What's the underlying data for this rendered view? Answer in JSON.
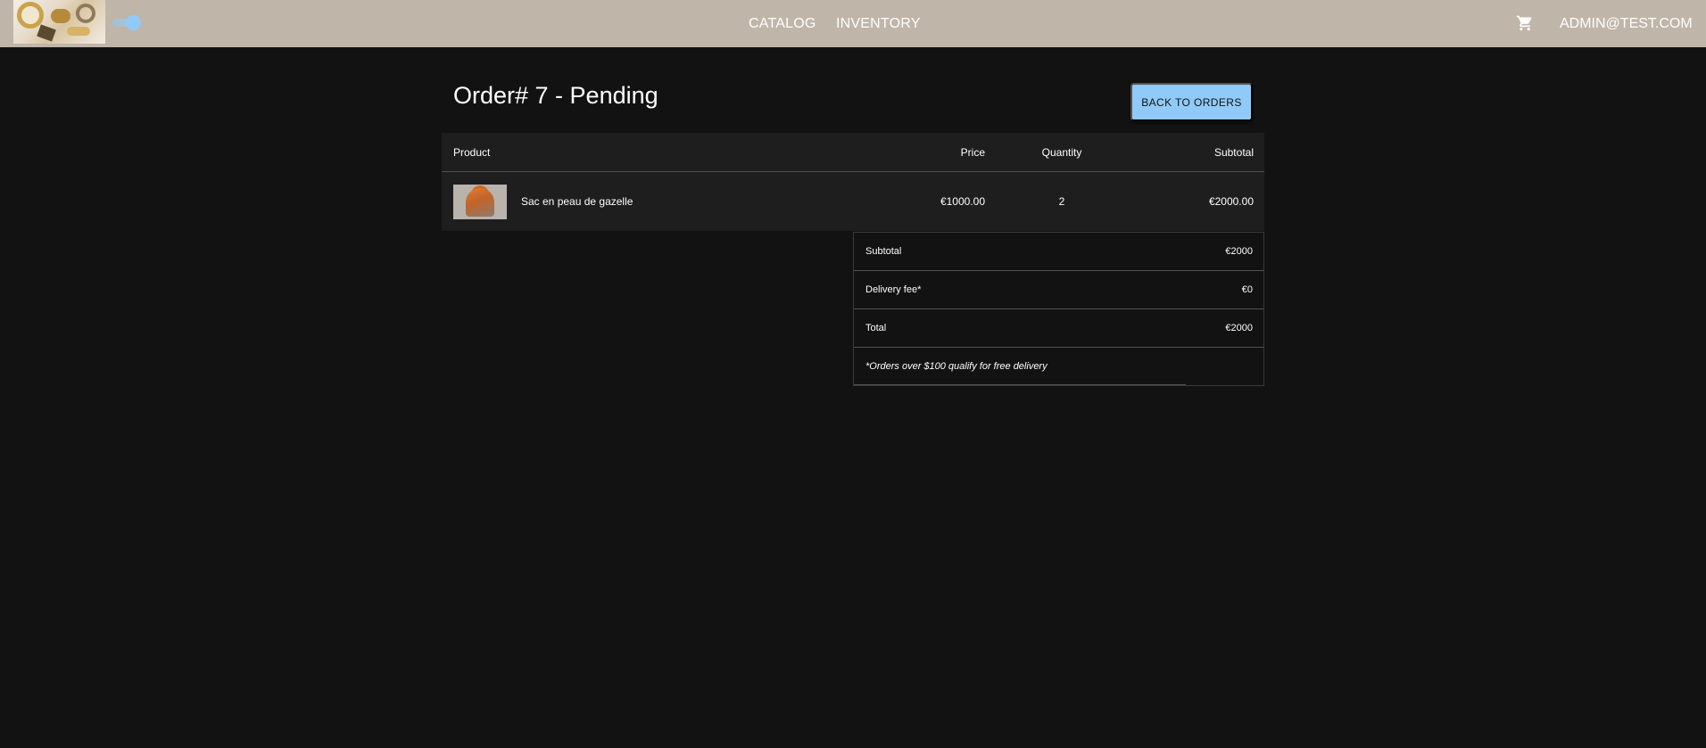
{
  "nav": {
    "catalog": "CATALOG",
    "inventory": "INVENTORY",
    "user": "ADMIN@TEST.COM"
  },
  "order": {
    "title": "Order# 7 - Pending",
    "back_label": "BACK TO ORDERS"
  },
  "table": {
    "headers": {
      "product": "Product",
      "price": "Price",
      "quantity": "Quantity",
      "subtotal": "Subtotal"
    },
    "rows": [
      {
        "name": "Sac en peau de gazelle",
        "price": "€1000.00",
        "quantity": "2",
        "subtotal": "€2000.00"
      }
    ]
  },
  "summary": {
    "subtotal_label": "Subtotal",
    "subtotal_value": "€2000",
    "delivery_label": "Delivery fee*",
    "delivery_value": "€0",
    "total_label": "Total",
    "total_value": "€2000",
    "note": "*Orders over $100 qualify for free delivery"
  },
  "colors": {
    "appbar": "#c0b5a9",
    "background": "#121212",
    "accent": "#90caf9"
  },
  "icons": [
    "logo-image",
    "theme-toggle",
    "cart-icon"
  ]
}
